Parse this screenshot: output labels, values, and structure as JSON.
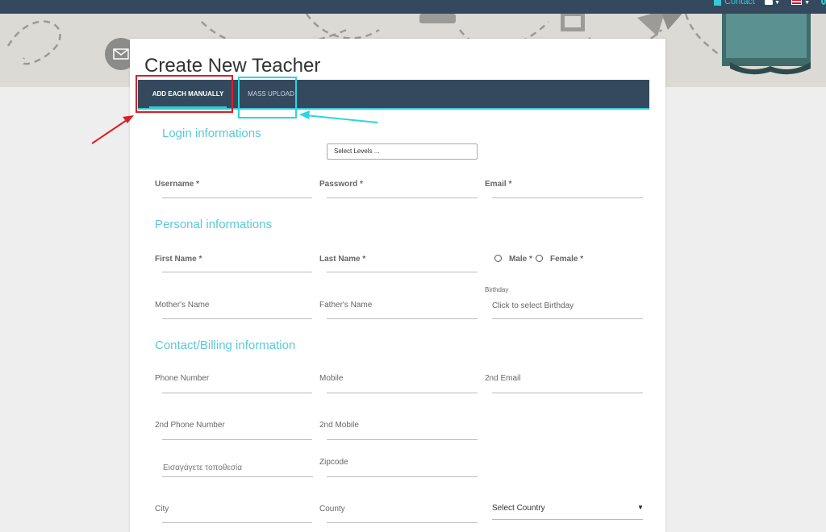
{
  "topbar": {
    "contact_label": "Contact"
  },
  "page": {
    "title": "Create New Teacher"
  },
  "tabs": [
    {
      "label": "ADD EACH MANUALLY"
    },
    {
      "label": "MASS UPLOAD"
    }
  ],
  "sections": {
    "login": "Login informations",
    "personal": "Personal informations",
    "contact": "Contact/Billing information"
  },
  "levels_select": {
    "value": "Select Levels ..."
  },
  "fields": {
    "username": "Username *",
    "password": "Password *",
    "email": "Email *",
    "first_name": "First Name *",
    "last_name": "Last Name *",
    "male": "Male *",
    "female": "Female *",
    "mothers_name": "Mother's Name",
    "fathers_name": "Father's Name",
    "birthday_label": "Birthday",
    "birthday_placeholder": "Click to select Birthday",
    "phone": "Phone Number",
    "mobile": "Mobile",
    "email2": "2nd Email",
    "phone2": "2nd Phone Number",
    "mobile2": "2nd Mobile",
    "location_placeholder": "Εισαγάγετε τοποθεσία",
    "zipcode": "Zipcode",
    "city": "City",
    "county": "County",
    "country_select": "Select Country"
  },
  "colors": {
    "header": "#34495e",
    "accent": "#36c9d6",
    "annotation_red": "#d72026",
    "annotation_cyan": "#2ad6e0"
  },
  "icons": [
    "envelope-icon",
    "bell-icon",
    "flag-icon",
    "dropdown-arrow-icon"
  ]
}
